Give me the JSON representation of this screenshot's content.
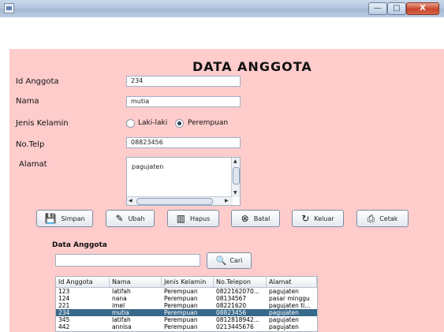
{
  "window": {
    "minimize_glyph": "—",
    "maximize_glyph": "□",
    "close_glyph": "X"
  },
  "form": {
    "title": "DATA ANGGOTA",
    "id_label": "Id Anggota",
    "id_value": "234",
    "nama_label": "Nama",
    "nama_value": "mutia",
    "jk_label": "Jenis Kelamin",
    "jk_option_male": "Laki-laki",
    "jk_option_female": "Perempuan",
    "jk_selected": "Perempuan",
    "telp_label": "No.Telp",
    "telp_value": "08823456",
    "alamat_label": "Alamat",
    "alamat_value": "pagujaten"
  },
  "buttons": {
    "simpan": "Simpan",
    "ubah": "Ubah",
    "hapus": "Hapus",
    "batal": "Batal",
    "keluar": "Keluar",
    "cetak": "Cetak"
  },
  "search": {
    "heading": "Data Anggota",
    "value": "",
    "button": "Cari"
  },
  "table": {
    "columns": [
      "Id Anggota",
      "Nama",
      "Jenis Kelamin",
      "No.Telepon",
      "Alamat"
    ],
    "rows": [
      [
        "123",
        "latifah",
        "Perempuan",
        "0822162070...",
        "pagujaten"
      ],
      [
        "124",
        "nana",
        "Perempuan",
        "08134567",
        "pasar minggu"
      ],
      [
        "221",
        "imel",
        "Perempuan",
        "08221620",
        "pagujaten ti..."
      ],
      [
        "234",
        "mutia",
        "Perempuan",
        "08823456",
        "pagujaten"
      ],
      [
        "345",
        "latifah",
        "Perempuan",
        "0812818942...",
        "pagujaten"
      ],
      [
        "442",
        "annisa",
        "Perempuan",
        "0213445676",
        "pagujaten"
      ]
    ],
    "selected_row": 3
  }
}
